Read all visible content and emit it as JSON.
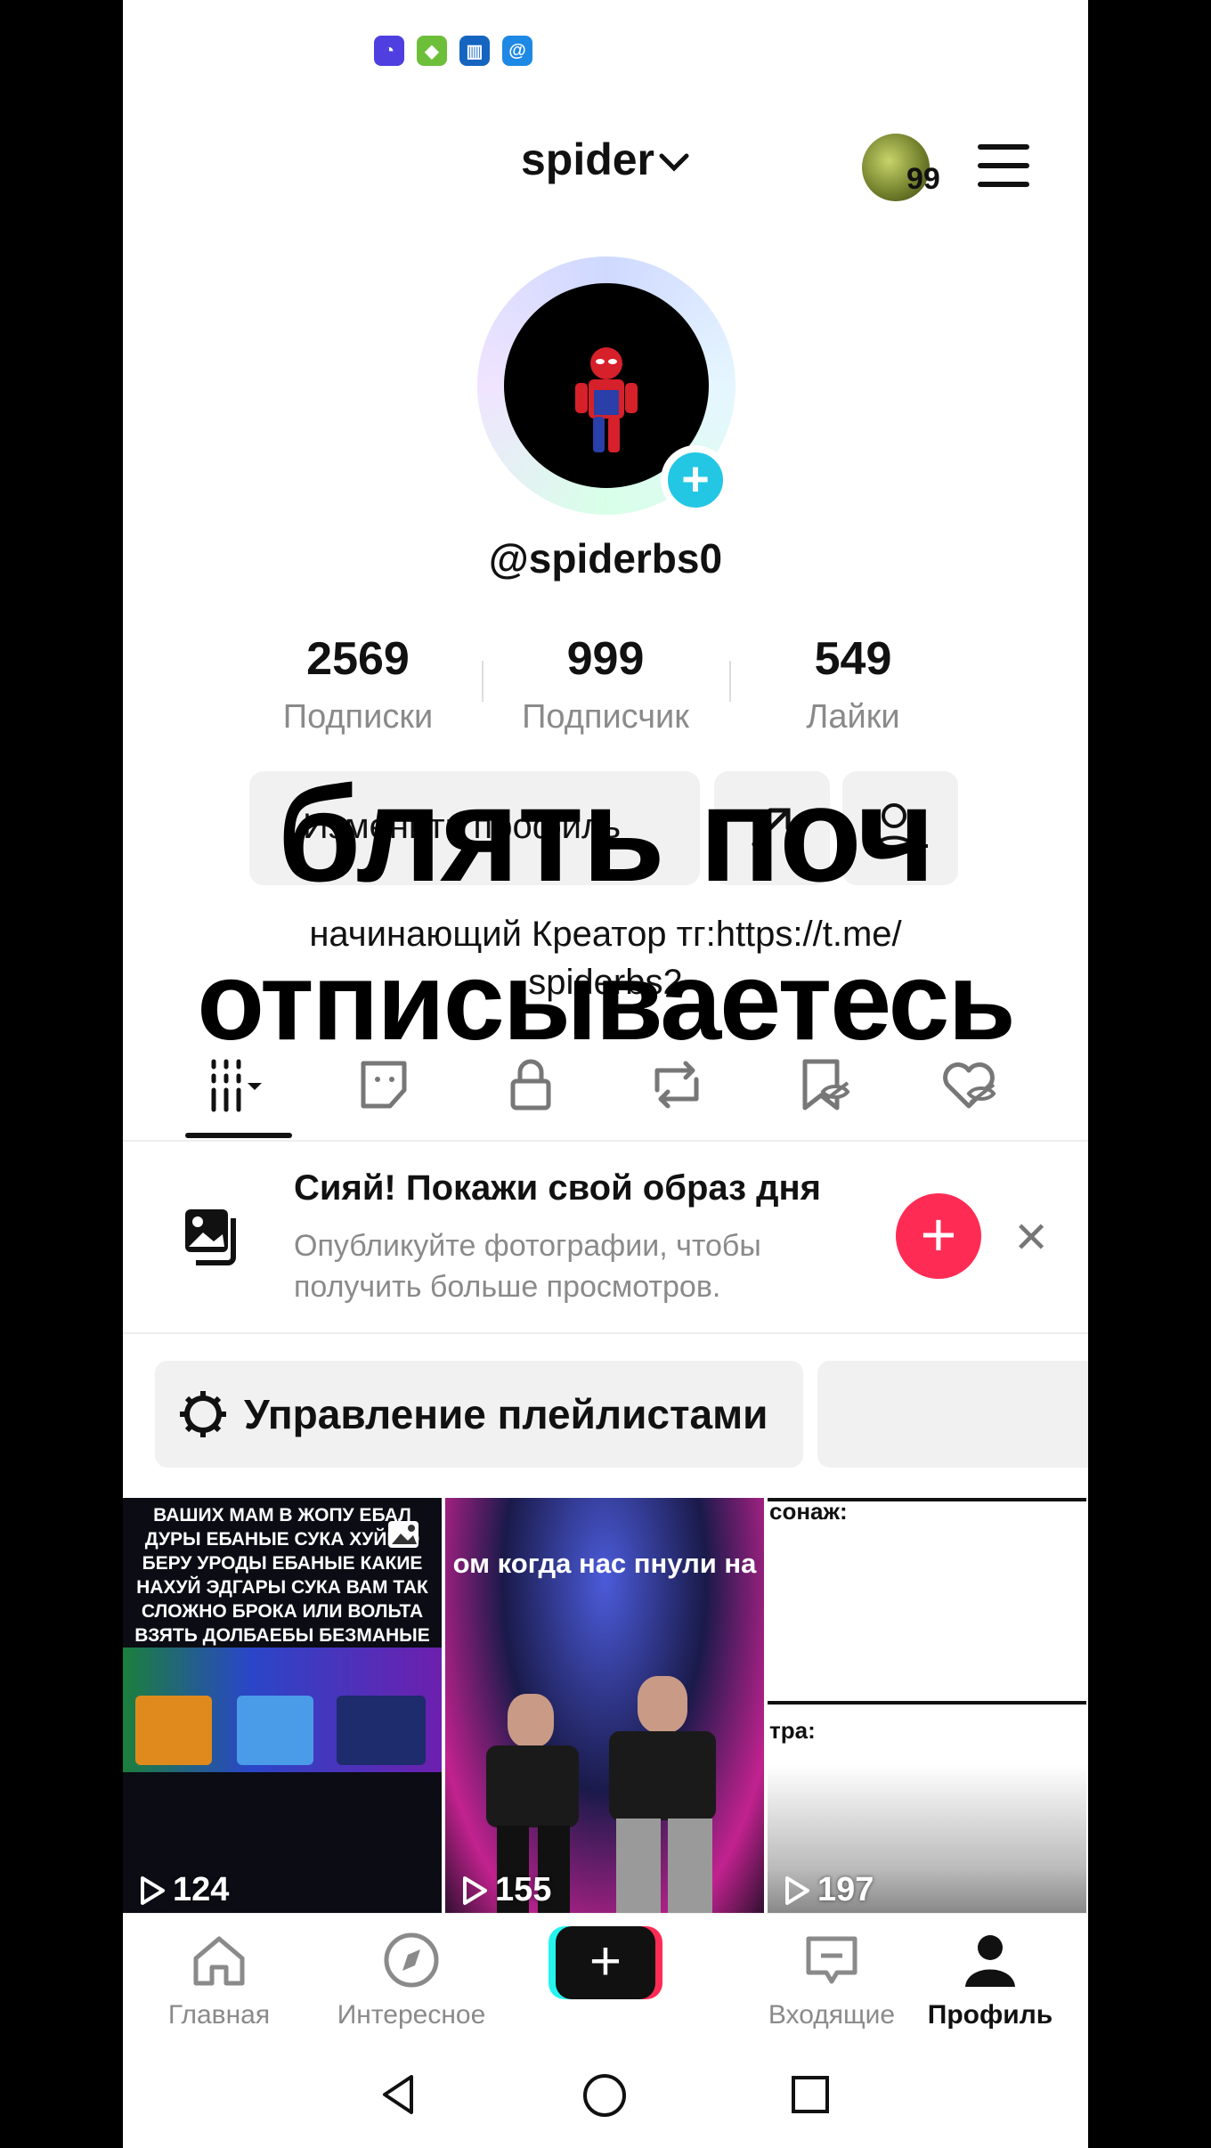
{
  "status_bar": {
    "icons": [
      {
        "name": "app-icon-1",
        "color": "#4f3fe0"
      },
      {
        "name": "app-icon-2",
        "color": "#6dbf3a"
      },
      {
        "name": "app-icon-3",
        "color": "#1565c0"
      },
      {
        "name": "app-icon-4",
        "color": "#1e88e5"
      }
    ]
  },
  "header": {
    "account_name": "spider",
    "coin_count": "99"
  },
  "profile": {
    "handle": "@spiderbs0",
    "stats": [
      {
        "value": "2569",
        "label": "Подписки"
      },
      {
        "value": "999",
        "label": "Подписчик"
      },
      {
        "value": "549",
        "label": "Лайки"
      }
    ],
    "edit_button": "Изменить профиль",
    "bio_line1": "начинающий Креатор тг:https://t.me/",
    "bio_line2": "spiderbs2"
  },
  "overlay_text": {
    "line1": "блять поч",
    "line2": "отписываетесь"
  },
  "tabs": [
    {
      "name": "videos-grid",
      "icon": "grid-icon",
      "active": true
    },
    {
      "name": "stickers",
      "icon": "sticker-icon"
    },
    {
      "name": "private",
      "icon": "lock-icon"
    },
    {
      "name": "reposts",
      "icon": "repost-icon"
    },
    {
      "name": "favorites-hidden",
      "icon": "bookmark-hidden-icon"
    },
    {
      "name": "likes-hidden",
      "icon": "heart-hidden-icon"
    }
  ],
  "promo": {
    "title": "Сияй! Покажи свой образ дня",
    "subtitle": "Опубликуйте фотографии, чтобы получить больше просмотров."
  },
  "playlists": {
    "manage_label": "Управление плейлистами"
  },
  "videos": [
    {
      "views": "124",
      "caption": "ВАШИХ МАМ В ЖОПУ ЕБАЛ ДУРЫ ЕБАНЫЕ СУКА ХУЙНЮ БЕРУ УРОДЫ ЕБАНЫЕ КАКИЕ НАХУЙ ЭДГАРЫ СУКА ВАМ ТАК СЛОЖНО БРОКА ИЛИ ВОЛЬТА ВЗЯТЬ ДОЛБАЕБЫ БЕЗМАНЫЕ СУКА НАХУЙ ЕБУЧИЕ БЛЯДИ"
    },
    {
      "views": "155",
      "caption": "ом когда нас пнули на"
    },
    {
      "views": "197",
      "caption_top": "сонаж:",
      "caption_mid": "тра:"
    }
  ],
  "bottom_nav": [
    {
      "label": "Главная",
      "icon": "home-icon"
    },
    {
      "label": "Интересное",
      "icon": "compass-icon"
    },
    {
      "label": "",
      "icon": "create-icon"
    },
    {
      "label": "Входящие",
      "icon": "inbox-icon"
    },
    {
      "label": "Профиль",
      "icon": "profile-icon",
      "active": true
    }
  ],
  "colors": {
    "accent_red": "#fe2c55",
    "accent_cyan": "#23c7e4",
    "muted_text": "#8a8a8a"
  }
}
